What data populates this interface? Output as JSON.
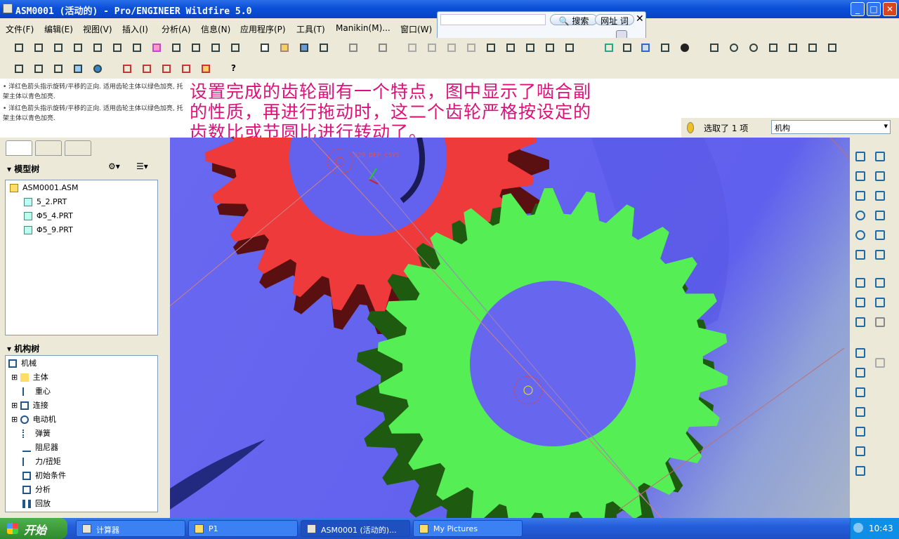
{
  "window": {
    "title": "ASM0001 (活动的) - Pro/ENGINEER Wildfire 5.0"
  },
  "menu": [
    "文件(F)",
    "编辑(E)",
    "视图(V)",
    "插入(I)",
    "分析(A)",
    "信息(N)",
    "应用程序(P)",
    "工具(T)",
    "Manikin(M)...",
    "窗口(W)"
  ],
  "search": {
    "search_label": "搜索",
    "url_label": "网址 词"
  },
  "messages": [
    "• 洋红色箭头指示旋转/平移的正向. 适用齿轮主体以绿色加亮, 托架主体以青色加亮.",
    "• 洋红色箭头指示旋转/平移的正向. 适用齿轮主体以绿色加亮, 托架主体以青色加亮."
  ],
  "annotation": {
    "line1": "设置完成的齿轮副有一个特点，图中显示了啮合副",
    "line2": "的性质，再进行拖动时，这二个齿轮严格按设定的",
    "line3": "齿数比或节圆比进行转动了。"
  },
  "selection": {
    "status": "选取了 1 项",
    "filter": "机构"
  },
  "model_tree": {
    "header": "模型树",
    "items": [
      "ASM0001.ASM",
      "5_2.PRT",
      "Φ5_4.PRT",
      "Φ5_9.PRT"
    ]
  },
  "mech_tree": {
    "header": "机构树",
    "items": [
      "机械",
      "主体",
      "重心",
      "连接",
      "电动机",
      "弹簧",
      "阻尼器",
      "力/扭矩",
      "初始条件",
      "分析",
      "回放"
    ]
  },
  "viewport": {
    "datum_label": "529_DEF_CSYS",
    "gear1_color": "#ee3a3a",
    "gear1_dark": "#5a1010",
    "gear2_color": "#55ee55",
    "gear2_dark": "#1e5a10",
    "background": "#6464ee"
  },
  "taskbar": {
    "start": "开始",
    "tasks": [
      "计算器",
      "P1",
      "ASM0001 (活动的)...",
      "My Pictures"
    ],
    "clock": "10:43"
  }
}
